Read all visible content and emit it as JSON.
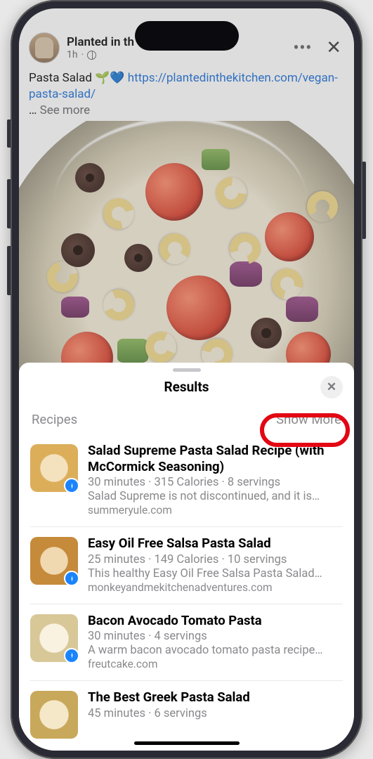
{
  "post": {
    "page_name": "Planted in th",
    "time": "1h",
    "text_prefix": "Pasta Salad 🌱💙 ",
    "link_text": "https://plantedinthekitchen.com/vegan-pasta-salad/",
    "ellipsis": "… ",
    "see_more": "See more"
  },
  "sheet": {
    "title": "Results",
    "section_label": "Recipes",
    "show_more": "Show More"
  },
  "recipes": [
    {
      "title": "Salad Supreme Pasta Salad Recipe (with McCormick Seasoning)",
      "meta": "30 minutes · 315 Calories · 8 servings",
      "desc": "Salad Supreme is not discontinued, and it is…",
      "src": "summeryule.com"
    },
    {
      "title": "Easy Oil Free Salsa Pasta Salad",
      "meta": "25 minutes · 149 Calories · 10 servings",
      "desc": "This healthy Easy Oil Free Salsa Pasta Salad…",
      "src": "monkeyandmekitchenadventures.com"
    },
    {
      "title": "Bacon Avocado Tomato Pasta",
      "meta": "30 minutes · 4 servings",
      "desc": "A warm bacon avocado tomato pasta recipe…",
      "src": "freutcake.com"
    },
    {
      "title": "The Best Greek Pasta Salad",
      "meta": "45 minutes · 6 servings",
      "desc": "",
      "src": ""
    }
  ]
}
